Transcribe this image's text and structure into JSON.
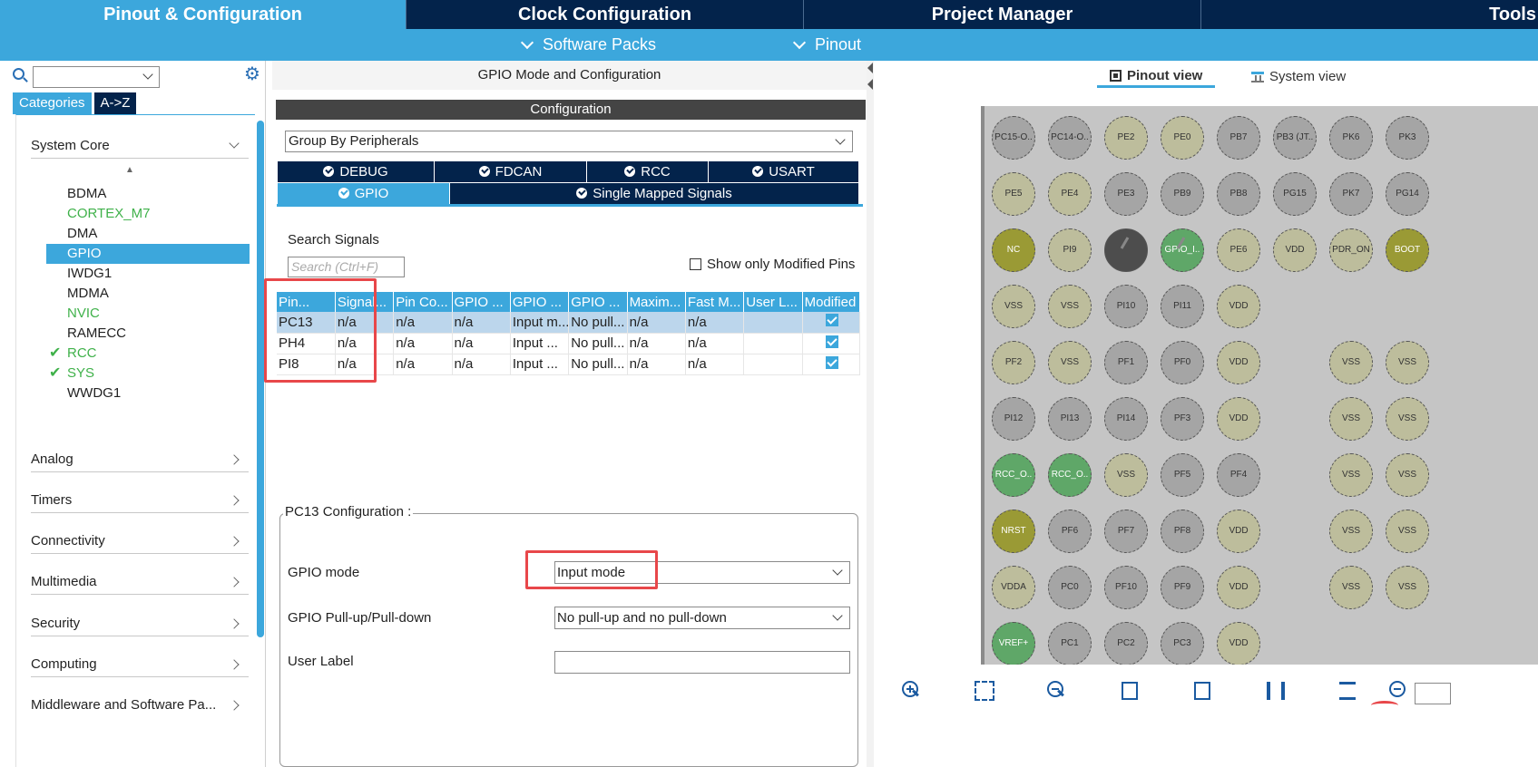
{
  "top_tabs": [
    {
      "label": "Pinout & Configuration",
      "active": true
    },
    {
      "label": "Clock Configuration",
      "active": false
    },
    {
      "label": "Project Manager",
      "active": false
    },
    {
      "label": "Tools",
      "active": false
    }
  ],
  "subbar": {
    "software_packs": "Software Packs",
    "pinout": "Pinout"
  },
  "left": {
    "search_value": "",
    "tabs": {
      "categories": "Categories",
      "az": "A->Z"
    },
    "groups": {
      "system_core": "System Core",
      "analog": "Analog",
      "timers": "Timers",
      "connectivity": "Connectivity",
      "multimedia": "Multimedia",
      "security": "Security",
      "computing": "Computing",
      "middleware": "Middleware and Software Pa..."
    },
    "peripherals": [
      {
        "label": "BDMA",
        "state": "normal"
      },
      {
        "label": "CORTEX_M7",
        "state": "green"
      },
      {
        "label": "DMA",
        "state": "normal"
      },
      {
        "label": "GPIO",
        "state": "selected"
      },
      {
        "label": "IWDG1",
        "state": "normal"
      },
      {
        "label": "MDMA",
        "state": "normal"
      },
      {
        "label": "NVIC",
        "state": "green"
      },
      {
        "label": "RAMECC",
        "state": "normal"
      },
      {
        "label": "RCC",
        "state": "checked"
      },
      {
        "label": "SYS",
        "state": "checked"
      },
      {
        "label": "WWDG1",
        "state": "normal"
      }
    ],
    "check_glyph": "✔"
  },
  "mid": {
    "title": "GPIO Mode and Configuration",
    "config_bar": "Configuration",
    "group_by": "Group By Peripherals",
    "peripheral_tabs": {
      "debug": "DEBUG",
      "fdcan": "FDCAN",
      "rcc": "RCC",
      "usart": "USART",
      "gpio": "GPIO",
      "single_mapped": "Single Mapped Signals"
    },
    "search_label": "Search Signals",
    "search_placeholder": "Search (Ctrl+F)",
    "show_modified": "Show only Modified Pins",
    "table": {
      "headers": [
        "Pin...",
        "Signal...",
        "Pin Co...",
        "GPIO ...",
        "GPIO ...",
        "GPIO ...",
        "Maxim...",
        "Fast M...",
        "User L...",
        "Modified"
      ],
      "rows": [
        [
          "PC13",
          "n/a",
          "n/a",
          "n/a",
          "Input m...",
          "No pull...",
          "n/a",
          "n/a",
          "",
          true
        ],
        [
          "PH4",
          "n/a",
          "n/a",
          "n/a",
          "Input ...",
          "No pull...",
          "n/a",
          "n/a",
          "",
          true
        ],
        [
          "PI8",
          "n/a",
          "n/a",
          "n/a",
          "Input ...",
          "No pull...",
          "n/a",
          "n/a",
          "",
          true
        ]
      ]
    },
    "pc13_config": {
      "legend": "PC13 Configuration :",
      "gpio_mode_label": "GPIO mode",
      "gpio_mode_value": "Input mode",
      "pull_label": "GPIO Pull-up/Pull-down",
      "pull_value": "No pull-up and no pull-down",
      "user_label_label": "User Label",
      "user_label_value": ""
    }
  },
  "right": {
    "pinout_view": "Pinout view",
    "system_view": "System view",
    "pins": [
      [
        "PC15-O..",
        "PC14-O..",
        "PE2",
        "PE0",
        "PB7",
        "PB3 (JT..",
        "PK6",
        "PK3"
      ],
      [
        "PE5",
        "PE4",
        "PE3",
        "PB9",
        "PB8",
        "PG15",
        "PK7",
        "PG14"
      ],
      [
        "NC",
        "PI9",
        "",
        "GPIO_I..",
        "PE6",
        "VDD",
        "PDR_ON",
        "BOOT"
      ],
      [
        "VSS",
        "VSS",
        "PI10",
        "PI11",
        "VDD",
        "",
        "",
        ""
      ],
      [
        "PF2",
        "VSS",
        "PF1",
        "PF0",
        "VDD",
        "",
        "VSS",
        "VSS"
      ],
      [
        "PI12",
        "PI13",
        "PI14",
        "PF3",
        "VDD",
        "",
        "VSS",
        "VSS"
      ],
      [
        "RCC_O..",
        "RCC_O..",
        "VSS",
        "PF5",
        "PF4",
        "",
        "VSS",
        "VSS"
      ],
      [
        "NRST",
        "PF6",
        "PF7",
        "PF8",
        "VDD",
        "",
        "VSS",
        "VSS"
      ],
      [
        "VDDA",
        "PC0",
        "PF10",
        "PF9",
        "VDD",
        "",
        "VSS",
        "VSS"
      ],
      [
        "VREF+",
        "PC1",
        "PC2",
        "PC3",
        "VDD",
        "",
        "",
        ""
      ]
    ],
    "pin_colors": [
      [
        "gray",
        "gray",
        "beige",
        "beige",
        "gray",
        "gray",
        "gray",
        "gray"
      ],
      [
        "beige",
        "beige",
        "gray",
        "gray",
        "gray",
        "gray",
        "gray",
        "gray"
      ],
      [
        "olive",
        "beige",
        "dark",
        "green",
        "beige",
        "beige",
        "beige",
        "olive"
      ],
      [
        "beige",
        "beige",
        "gray",
        "gray",
        "beige",
        "",
        "",
        ""
      ],
      [
        "beige",
        "beige",
        "gray",
        "gray",
        "beige",
        "",
        "beige",
        "beige"
      ],
      [
        "gray",
        "gray",
        "gray",
        "gray",
        "beige",
        "",
        "beige",
        "beige"
      ],
      [
        "green",
        "green",
        "beige",
        "gray",
        "gray",
        "",
        "beige",
        "beige"
      ],
      [
        "olive",
        "gray",
        "gray",
        "gray",
        "beige",
        "",
        "beige",
        "beige"
      ],
      [
        "beige",
        "gray",
        "gray",
        "gray",
        "beige",
        "",
        "beige",
        "beige"
      ],
      [
        "green",
        "gray",
        "gray",
        "gray",
        "beige",
        "",
        "",
        ""
      ]
    ],
    "toolbar_icons": [
      "zoom-in-icon",
      "fit-screen-icon",
      "zoom-out-icon",
      "rotate-right-icon",
      "rotate-left-icon",
      "flip-horizontal-icon",
      "flip-vertical-icon",
      "search-icon"
    ]
  },
  "colors": {
    "accent": "#3ca7dc",
    "dark_navy": "#03234b",
    "green": "#3fb14a",
    "highlight_red": "#e8474a"
  }
}
